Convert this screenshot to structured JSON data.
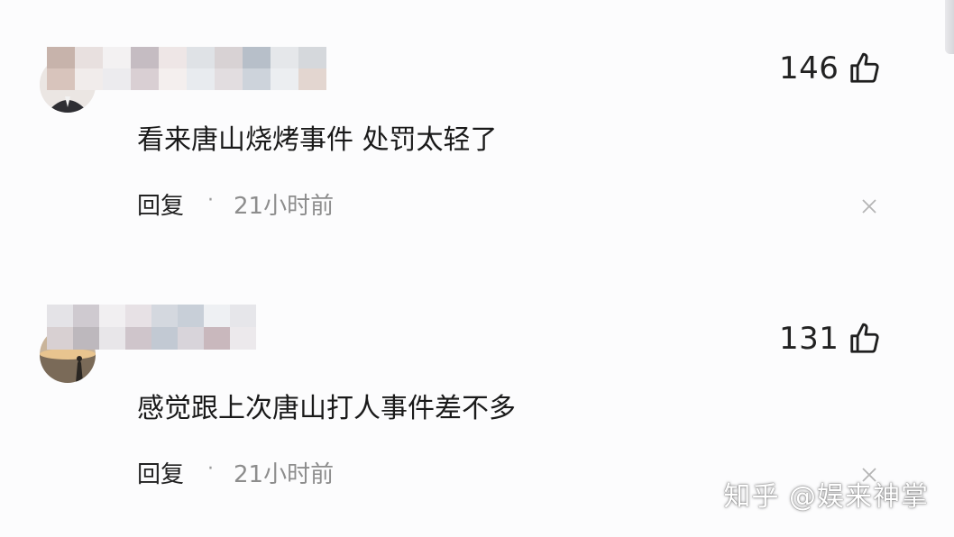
{
  "comments": [
    {
      "likes": "146",
      "text": "看来唐山烧烤事件 处罚太轻了",
      "reply_label": "回复",
      "separator": "·",
      "time": "21小时前"
    },
    {
      "likes": "131",
      "text": "感觉跟上次唐山打人事件差不多",
      "reply_label": "回复",
      "separator": "·",
      "time": "21小时前"
    }
  ],
  "icons": {
    "like": "thumbs-up-icon",
    "close": "close-icon"
  },
  "watermark": "知乎 @娱来神掌",
  "colors": {
    "text": "#1a1a1a",
    "meta": "#8d8d8d",
    "background": "#fcfcfd"
  }
}
